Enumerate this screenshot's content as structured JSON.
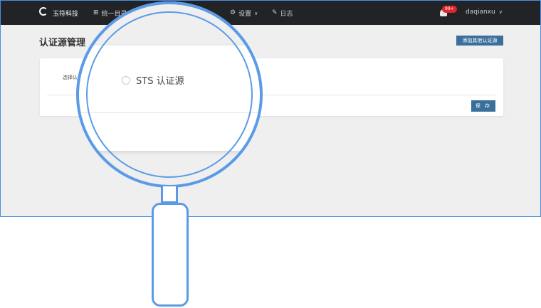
{
  "nav": {
    "brand": "玉符科技",
    "items": [
      {
        "icon": "catalog-icon",
        "label": "统一目录"
      },
      {
        "icon": "settings-icon",
        "label": "设置"
      },
      {
        "icon": "log-icon",
        "label": "日志"
      }
    ],
    "notifications_badge": "99+",
    "username": "daqianxu"
  },
  "page": {
    "title": "认证源管理",
    "add_button": "添加其他认证源"
  },
  "form": {
    "label": "选择认",
    "option_label": "STS 认证源",
    "save_button": "保 存"
  },
  "colors": {
    "topbar": "#222326",
    "primary_button": "#3b6f9b",
    "badge": "#e0262a",
    "magnifier": "#5b9be6"
  }
}
